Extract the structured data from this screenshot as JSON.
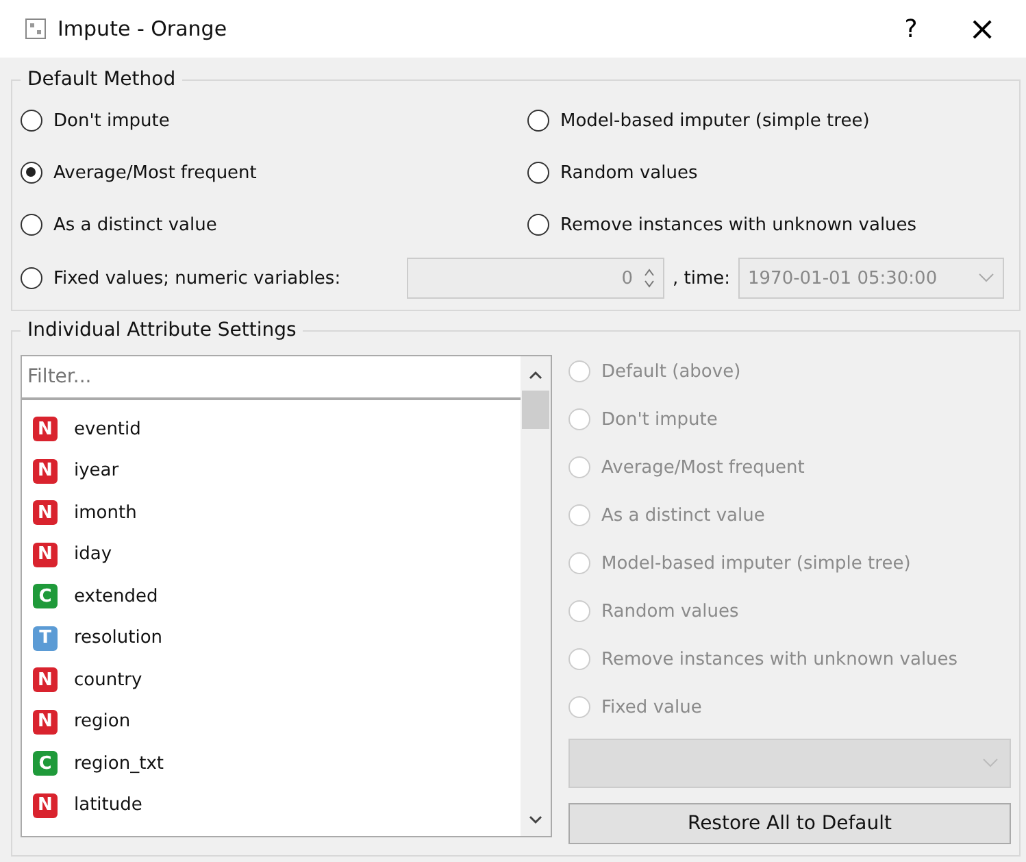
{
  "window": {
    "title": "Impute - Orange",
    "help": "?",
    "close": "×"
  },
  "default_method": {
    "title": "Default Method",
    "options": [
      {
        "label": "Don't impute",
        "selected": false
      },
      {
        "label": "Model-based imputer (simple tree)",
        "selected": false
      },
      {
        "label": "Average/Most frequent",
        "selected": true
      },
      {
        "label": "Random values",
        "selected": false
      },
      {
        "label": "As a distinct value",
        "selected": false
      },
      {
        "label": "Remove instances with unknown values",
        "selected": false
      }
    ],
    "fixed": {
      "label": "Fixed values; numeric variables:",
      "selected": false,
      "value": "0",
      "disabled": true,
      "time_label": ", time:",
      "time_value": "1970-01-01 05:30:00",
      "time_disabled": true
    }
  },
  "individual": {
    "title": "Individual Attribute Settings",
    "filter": {
      "placeholder": "Filter..."
    },
    "attributes": [
      {
        "type": "N",
        "name": "eventid",
        "color": "#d9232e"
      },
      {
        "type": "N",
        "name": "iyear",
        "color": "#d9232e"
      },
      {
        "type": "N",
        "name": "imonth",
        "color": "#d9232e"
      },
      {
        "type": "N",
        "name": "iday",
        "color": "#d9232e"
      },
      {
        "type": "C",
        "name": "extended",
        "color": "#1f9a3a"
      },
      {
        "type": "T",
        "name": "resolution",
        "color": "#5b9bd5"
      },
      {
        "type": "N",
        "name": "country",
        "color": "#d9232e"
      },
      {
        "type": "N",
        "name": "region",
        "color": "#d9232e"
      },
      {
        "type": "C",
        "name": "region_txt",
        "color": "#1f9a3a"
      },
      {
        "type": "N",
        "name": "latitude",
        "color": "#d9232e"
      }
    ],
    "methods": [
      {
        "label": "Default (above)",
        "selected": false,
        "disabled": true
      },
      {
        "label": "Don't impute",
        "selected": false,
        "disabled": true
      },
      {
        "label": "Average/Most frequent",
        "selected": false,
        "disabled": true
      },
      {
        "label": "As a distinct value",
        "selected": false,
        "disabled": true
      },
      {
        "label": "Model-based imputer (simple tree)",
        "selected": false,
        "disabled": true
      },
      {
        "label": "Random values",
        "selected": false,
        "disabled": true
      },
      {
        "label": "Remove instances with unknown values",
        "selected": false,
        "disabled": true
      },
      {
        "label": "Fixed value",
        "selected": false,
        "disabled": true
      }
    ],
    "value_combo": {
      "disabled": true
    },
    "restore_button": "Restore All to Default"
  }
}
